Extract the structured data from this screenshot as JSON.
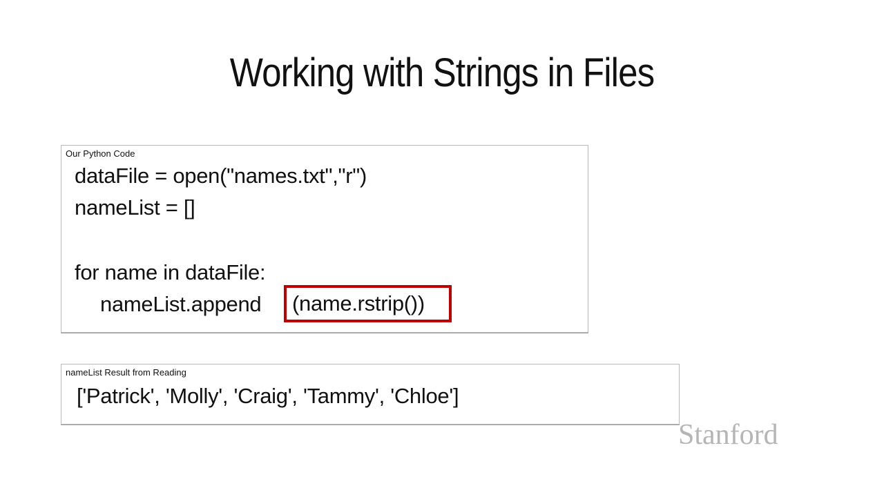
{
  "slide": {
    "title": "Working with Strings in Files"
  },
  "code_panel": {
    "caption": "Our Python Code",
    "lines": [
      "dataFile = open(\"names.txt\",\"r\")",
      "nameList = []",
      "for name in dataFile:",
      "nameList.append"
    ],
    "highlighted": "(name.rstrip())",
    "highlight_color": "#c00000"
  },
  "result_panel": {
    "caption": "nameList Result from Reading",
    "value": "['Patrick', 'Molly', 'Craig', 'Tammy', 'Chloe']"
  },
  "logo": {
    "text": "Stanford",
    "color": "#b5b5b5"
  }
}
